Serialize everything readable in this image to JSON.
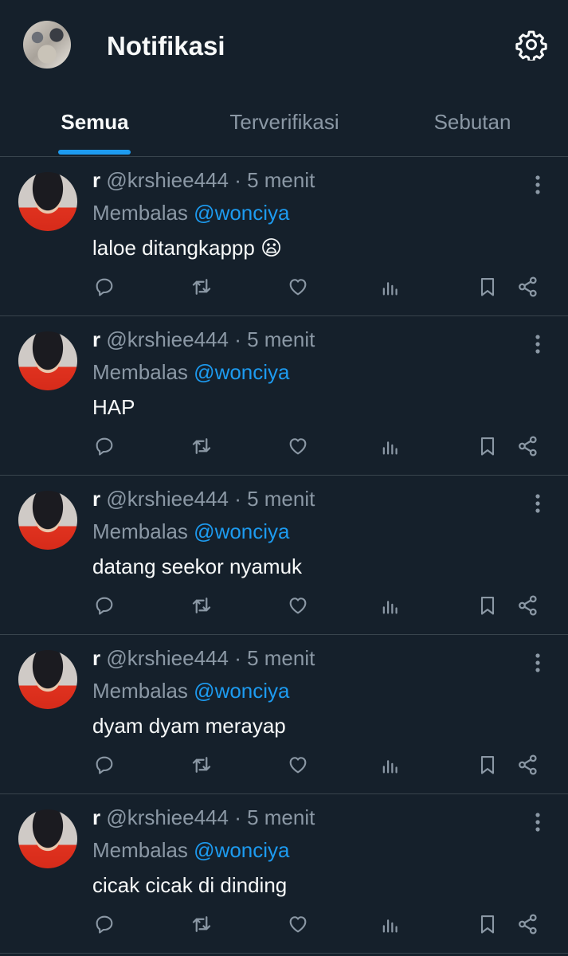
{
  "header": {
    "title": "Notifikasi",
    "avatar_icon": "profile-avatar",
    "settings_icon": "gear-icon"
  },
  "tabs": [
    {
      "label": "Semua",
      "active": true
    },
    {
      "label": "Terverifikasi",
      "active": false
    },
    {
      "label": "Sebutan",
      "active": false
    }
  ],
  "colors": {
    "background": "#15202b",
    "accent": "#1d9bf0",
    "muted_text": "#8b98a5",
    "primary_text": "#f7f9f9",
    "divider": "#38444d"
  },
  "posts": [
    {
      "name": "r",
      "handle": "@krshiee444",
      "dot": "·",
      "time": "5 menit",
      "reply_prefix": "Membalas",
      "reply_to": "@wonciya",
      "text": "laloe ditangkappp 😦"
    },
    {
      "name": "r",
      "handle": "@krshiee444",
      "dot": "·",
      "time": "5 menit",
      "reply_prefix": "Membalas",
      "reply_to": "@wonciya",
      "text": "HAP"
    },
    {
      "name": "r",
      "handle": "@krshiee444",
      "dot": "·",
      "time": "5 menit",
      "reply_prefix": "Membalas",
      "reply_to": "@wonciya",
      "text": "datang seekor nyamuk"
    },
    {
      "name": "r",
      "handle": "@krshiee444",
      "dot": "·",
      "time": "5 menit",
      "reply_prefix": "Membalas",
      "reply_to": "@wonciya",
      "text": "dyam dyam merayap"
    },
    {
      "name": "r",
      "handle": "@krshiee444",
      "dot": "·",
      "time": "5 menit",
      "reply_prefix": "Membalas",
      "reply_to": "@wonciya",
      "text": "cicak cicak di dinding"
    }
  ],
  "post_actions": [
    "reply-icon",
    "retweet-icon",
    "heart-icon",
    "views-icon",
    "bookmark-icon",
    "share-icon"
  ]
}
